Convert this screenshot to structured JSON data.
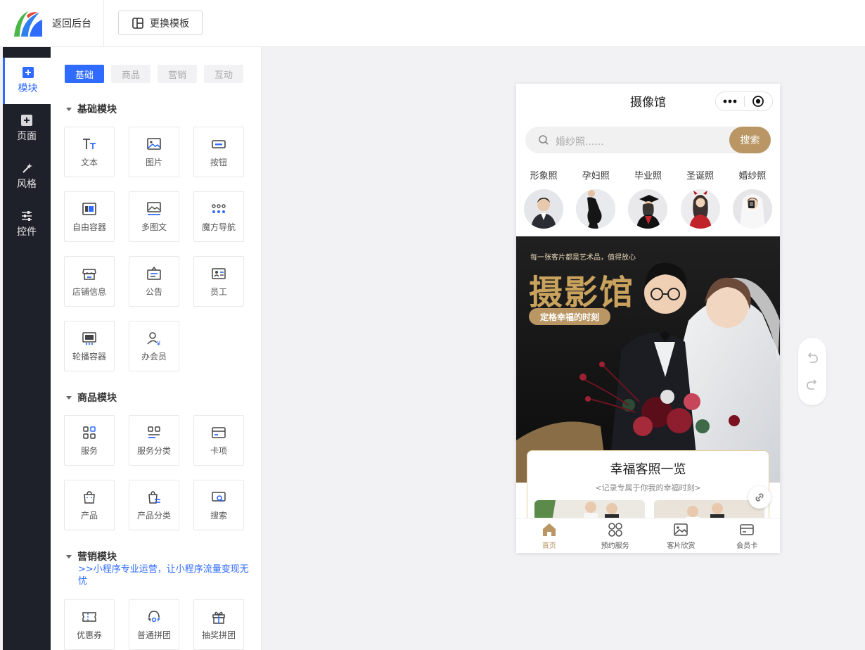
{
  "topbar": {
    "back_label": "返回后台",
    "template_label": "更换模板"
  },
  "rail": {
    "items": [
      {
        "label": "模块",
        "icon": "plus-square-icon",
        "active": true
      },
      {
        "label": "页面",
        "icon": "page-plus-icon",
        "active": false
      },
      {
        "label": "风格",
        "icon": "magic-wand-icon",
        "active": false
      },
      {
        "label": "控件",
        "icon": "sliders-icon",
        "active": false
      }
    ]
  },
  "panel": {
    "tabs": [
      {
        "label": "基础",
        "active": true
      },
      {
        "label": "商品",
        "active": false
      },
      {
        "label": "营销",
        "active": false
      },
      {
        "label": "互动",
        "active": false
      }
    ],
    "basic": {
      "title": "基础模块",
      "items": [
        "文本",
        "图片",
        "按钮",
        "自由容器",
        "多图文",
        "魔方导航",
        "店铺信息",
        "公告",
        "员工",
        "轮播容器",
        "办会员"
      ]
    },
    "goods": {
      "title": "商品模块",
      "items": [
        "服务",
        "服务分类",
        "卡项",
        "产品",
        "产品分类",
        "搜索"
      ]
    },
    "marketing": {
      "title": "营销模块",
      "promo": ">>小程序专业运营，让小程序流量变现无忧",
      "items": [
        "优惠券",
        "普通拼团",
        "抽奖拼团"
      ]
    }
  },
  "phone": {
    "title": "摄像馆",
    "search_placeholder": "婚纱照......",
    "search_button": "搜索",
    "categories": [
      "形象照",
      "孕妇照",
      "毕业照",
      "圣诞照",
      "婚纱照"
    ],
    "banner": {
      "tagline": "每一张客片都是艺术品，值得放心",
      "headline": "摄影馆",
      "pill": "定格幸福的时刻"
    },
    "gallery": {
      "title": "幸福客照一览",
      "subtitle": "<记录专属于你我的幸福时刻>"
    },
    "tabbar": [
      {
        "label": "首页",
        "icon": "home-icon",
        "active": true
      },
      {
        "label": "预约服务",
        "icon": "grid-circles-icon",
        "active": false
      },
      {
        "label": "客片欣赏",
        "icon": "image-icon",
        "active": false
      },
      {
        "label": "会员卡",
        "icon": "card-icon",
        "active": false
      }
    ]
  },
  "colors": {
    "primary": "#2f6bff",
    "rail": "#1e2129",
    "gold": "#b99664",
    "gold_text": "#c9a25d"
  }
}
